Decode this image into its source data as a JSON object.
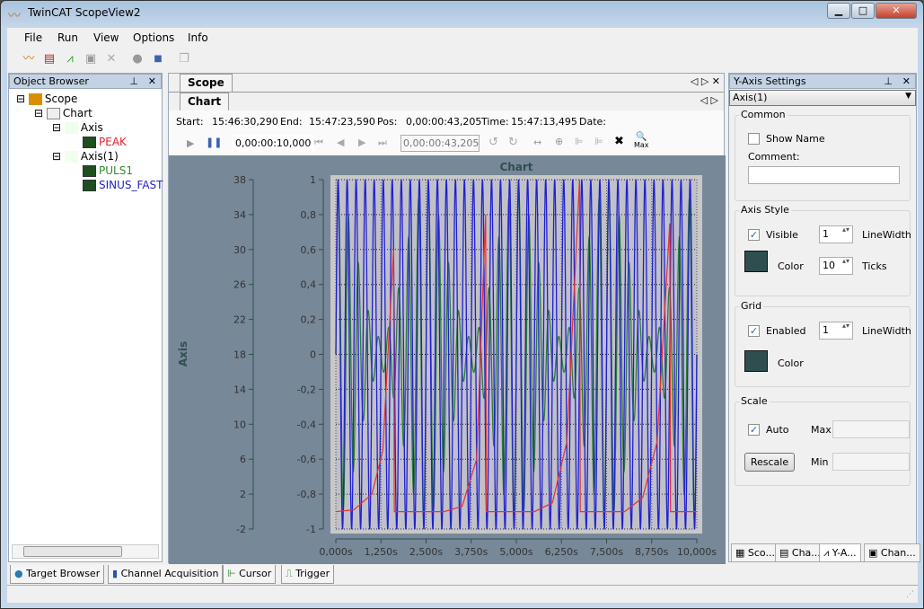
{
  "window": {
    "title": "TwinCAT ScopeView2",
    "minimize": "▁",
    "maximize": "□",
    "close": "✕"
  },
  "menu": [
    "File",
    "Run",
    "View",
    "Options",
    "Info"
  ],
  "object_browser": {
    "title": "Object Browser",
    "items": [
      {
        "label": "Scope",
        "color": "#000000"
      },
      {
        "label": "Chart",
        "color": "#000000"
      },
      {
        "label": "Axis",
        "color": "#000000"
      },
      {
        "label": "PEAK",
        "color": "#e8222b"
      },
      {
        "label": "Axis(1)",
        "color": "#000000"
      },
      {
        "label": "PULS1",
        "color": "#2e8b2e"
      },
      {
        "label": "SINUS_FAST",
        "color": "#2222cc"
      }
    ]
  },
  "scope": {
    "tab": "Scope",
    "chart_tab": "Chart",
    "info": {
      "start_label": "Start:",
      "start": "15:46:30,290",
      "end_label": "End:",
      "end": "15:47:23,590",
      "pos_label": "Pos:",
      "pos": "0,00:00:43,205",
      "time_label": "Time:",
      "time": "15:47:13,495",
      "date_label": "Date:"
    },
    "timespan": "0,00:00:10,000",
    "position_field": "0,00:00:43,205",
    "zoom_max_label": "Max"
  },
  "chart_data": {
    "type": "line",
    "title": "Chart",
    "ylabel": "Axis",
    "x_ticks": [
      "0,000s",
      "1,250s",
      "2,500s",
      "3,750s",
      "5,000s",
      "6,250s",
      "7,500s",
      "8,750s",
      "10,000s"
    ],
    "xlim": [
      0,
      10
    ],
    "axes": [
      {
        "name": "Axis",
        "ticks": [
          "38",
          "34",
          "30",
          "26",
          "22",
          "18",
          "14",
          "10",
          "6",
          "2",
          "-2"
        ],
        "ylim": [
          -2,
          38
        ]
      },
      {
        "name": "Axis(1)",
        "ticks": [
          "1",
          "0,8",
          "0,6",
          "0,4",
          "0,2",
          "0",
          "-0,2",
          "-0,4",
          "-0,6",
          "-0,8",
          "-1"
        ],
        "ylim": [
          -1,
          1
        ]
      }
    ],
    "grid": true,
    "series": [
      {
        "name": "SINUS_FAST",
        "color": "#2020d0",
        "axis": "Axis(1)",
        "frequency_hz": 4,
        "amplitude": 1
      },
      {
        "name": "PULS1",
        "color": "#2e7d32",
        "axis": "Axis(1)",
        "frequency_hz": 3.6,
        "amplitude": 0.95
      },
      {
        "name": "PEAK",
        "color": "#e83030",
        "axis": "Axis(1)",
        "x": [
          0,
          0.5,
          1.0,
          1.3,
          1.6,
          1.62,
          3.0,
          3.5,
          3.9,
          4.15,
          4.17,
          5.5,
          6.0,
          6.4,
          6.75,
          6.77,
          8.0,
          8.5,
          8.9,
          9.25,
          9.27,
          10
        ],
        "values": [
          -0.9,
          -0.89,
          -0.8,
          -0.55,
          0.6,
          -0.9,
          -0.9,
          -0.87,
          -0.6,
          0.8,
          -0.9,
          -0.9,
          -0.85,
          -0.5,
          1.0,
          -0.9,
          -0.9,
          -0.82,
          -0.5,
          0.75,
          -0.9,
          -0.9
        ]
      }
    ]
  },
  "y_axis_settings": {
    "title": "Y-Axis Settings",
    "selected_axis": "Axis(1)",
    "common": {
      "title": "Common",
      "show_name": "Show Name",
      "show_name_checked": false,
      "comment_label": "Comment:",
      "comment": ""
    },
    "axis_style": {
      "title": "Axis Style",
      "visible": "Visible",
      "visible_checked": true,
      "linewidth": "1",
      "linewidth_label": "LineWidth",
      "color_label": "Color",
      "color": "#2f4f4f",
      "ticks": "10",
      "ticks_label": "Ticks"
    },
    "grid": {
      "title": "Grid",
      "enabled": "Enabled",
      "enabled_checked": true,
      "linewidth": "1",
      "linewidth_label": "LineWidth",
      "color_label": "Color",
      "color": "#2f4f4f"
    },
    "scale": {
      "title": "Scale",
      "auto": "Auto",
      "auto_checked": true,
      "max_label": "Max",
      "max": "",
      "rescale": "Rescale",
      "min_label": "Min",
      "min": ""
    }
  },
  "right_tabs": [
    "Sco...",
    "Cha...",
    "Y-A...",
    "Chan..."
  ],
  "bottom_tabs": [
    "Target Browser",
    "Channel Acquisition",
    "Cursor",
    "Trigger"
  ]
}
